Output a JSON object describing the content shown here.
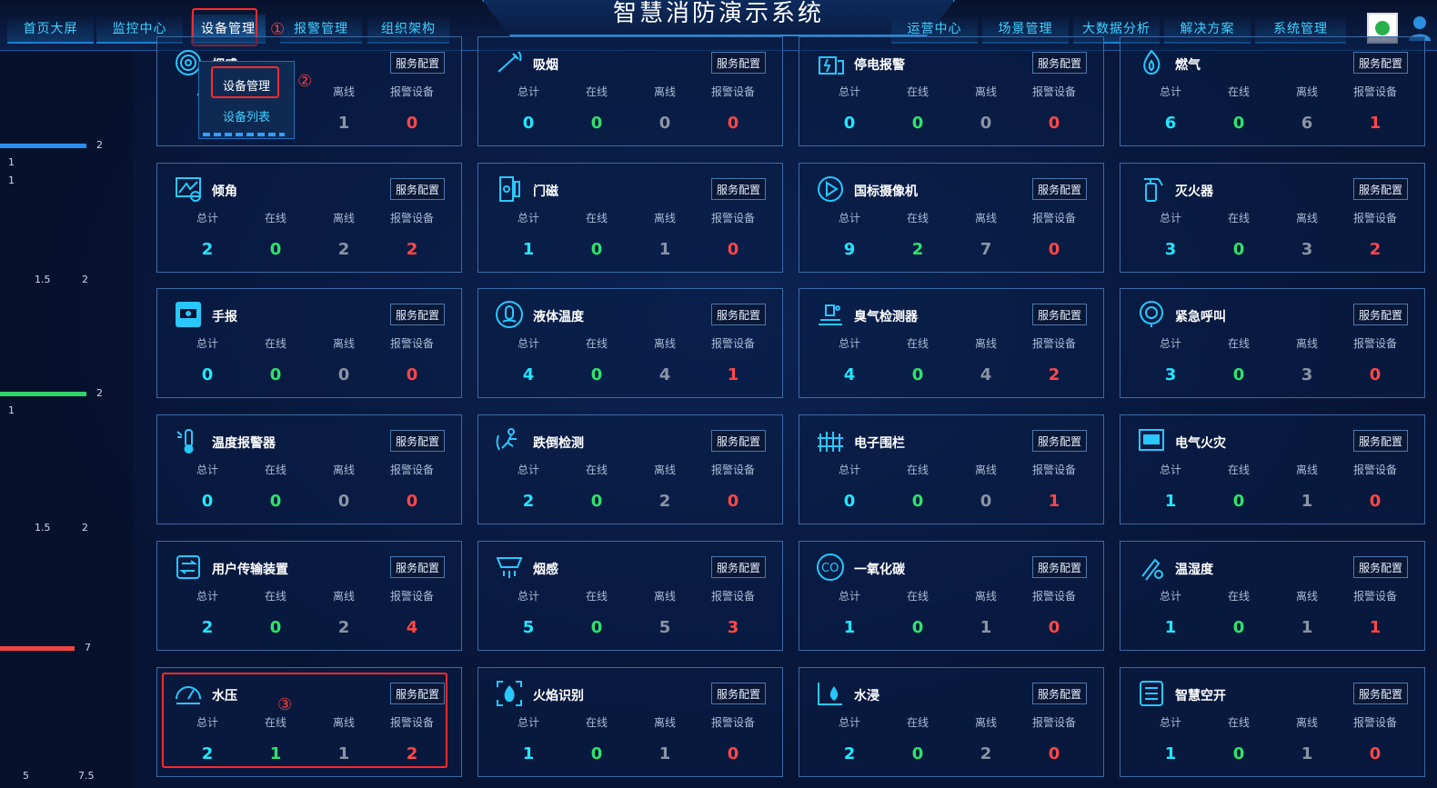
{
  "app": {
    "title": "智慧消防演示系统"
  },
  "nav_left": [
    "首页大屏",
    "监控中心",
    "设备管理",
    "报警管理",
    "组织架构"
  ],
  "nav_right": [
    "运营中心",
    "场景管理",
    "大数据分析",
    "解决方案",
    "系统管理"
  ],
  "dropdown": {
    "items": [
      "设备管理",
      "设备列表"
    ]
  },
  "markers": {
    "m1": "①",
    "m2": "②",
    "m3": "③"
  },
  "labels": {
    "total": "总计",
    "online": "在线",
    "offline": "离线",
    "alarm": "报警设备",
    "service_config": "服务配置"
  },
  "left_panel": {
    "bars": [
      {
        "value": "2",
        "color": "#2a8ef0"
      },
      {
        "value": "2",
        "color": "#2ed36a"
      },
      {
        "value": "7",
        "color": "#f04444"
      }
    ],
    "ticks": [
      "1",
      "1",
      "1.5",
      "2",
      "1",
      "1.5",
      "2",
      "5",
      "7.5"
    ]
  },
  "cards": [
    {
      "name": "烟感",
      "icon": "smoke-sensor-icon",
      "total": "",
      "online": "",
      "offline": "1",
      "alarm": "0"
    },
    {
      "name": "吸烟",
      "icon": "smoking-icon",
      "total": "0",
      "online": "0",
      "offline": "0",
      "alarm": "0"
    },
    {
      "name": "停电报警",
      "icon": "power-outage-icon",
      "total": "0",
      "online": "0",
      "offline": "0",
      "alarm": "0"
    },
    {
      "name": "燃气",
      "icon": "gas-flame-icon",
      "total": "6",
      "online": "0",
      "offline": "6",
      "alarm": "1"
    },
    {
      "name": "倾角",
      "icon": "tilt-icon",
      "total": "2",
      "online": "0",
      "offline": "2",
      "alarm": "2"
    },
    {
      "name": "门磁",
      "icon": "door-magnet-icon",
      "total": "1",
      "online": "0",
      "offline": "1",
      "alarm": "0"
    },
    {
      "name": "国标摄像机",
      "icon": "camera-play-icon",
      "total": "9",
      "online": "2",
      "offline": "7",
      "alarm": "0"
    },
    {
      "name": "灭火器",
      "icon": "extinguisher-icon",
      "total": "3",
      "online": "0",
      "offline": "3",
      "alarm": "2"
    },
    {
      "name": "手报",
      "icon": "manual-alarm-icon",
      "total": "0",
      "online": "0",
      "offline": "0",
      "alarm": "0"
    },
    {
      "name": "液体温度",
      "icon": "liquid-temp-icon",
      "total": "4",
      "online": "0",
      "offline": "4",
      "alarm": "1"
    },
    {
      "name": "臭气检测器",
      "icon": "odor-detector-icon",
      "total": "4",
      "online": "0",
      "offline": "4",
      "alarm": "2"
    },
    {
      "name": "紧急呼叫",
      "icon": "emergency-call-icon",
      "total": "3",
      "online": "0",
      "offline": "3",
      "alarm": "0"
    },
    {
      "name": "温度报警器",
      "icon": "thermometer-icon",
      "total": "0",
      "online": "0",
      "offline": "0",
      "alarm": "0"
    },
    {
      "name": "跌倒检测",
      "icon": "fall-detect-icon",
      "total": "2",
      "online": "0",
      "offline": "2",
      "alarm": "0"
    },
    {
      "name": "电子围栏",
      "icon": "fence-icon",
      "total": "0",
      "online": "0",
      "offline": "0",
      "alarm": "1"
    },
    {
      "name": "电气火灾",
      "icon": "electric-fire-icon",
      "total": "1",
      "online": "0",
      "offline": "1",
      "alarm": "0"
    },
    {
      "name": "用户传输装置",
      "icon": "transmission-icon",
      "total": "2",
      "online": "0",
      "offline": "2",
      "alarm": "4"
    },
    {
      "name": "烟感",
      "icon": "smoke-detector-icon",
      "total": "5",
      "online": "0",
      "offline": "5",
      "alarm": "3"
    },
    {
      "name": "一氧化碳",
      "icon": "co-icon",
      "total": "1",
      "online": "0",
      "offline": "1",
      "alarm": "0"
    },
    {
      "name": "温湿度",
      "icon": "humidity-icon",
      "total": "1",
      "online": "0",
      "offline": "1",
      "alarm": "1"
    },
    {
      "name": "水压",
      "icon": "pressure-gauge-icon",
      "total": "2",
      "online": "1",
      "offline": "1",
      "alarm": "2"
    },
    {
      "name": "火焰识别",
      "icon": "flame-detect-icon",
      "total": "1",
      "online": "0",
      "offline": "1",
      "alarm": "0"
    },
    {
      "name": "水浸",
      "icon": "water-leak-icon",
      "total": "2",
      "online": "0",
      "offline": "2",
      "alarm": "0"
    },
    {
      "name": "智慧空开",
      "icon": "smart-switch-icon",
      "total": "1",
      "online": "0",
      "offline": "1",
      "alarm": "0"
    }
  ]
}
